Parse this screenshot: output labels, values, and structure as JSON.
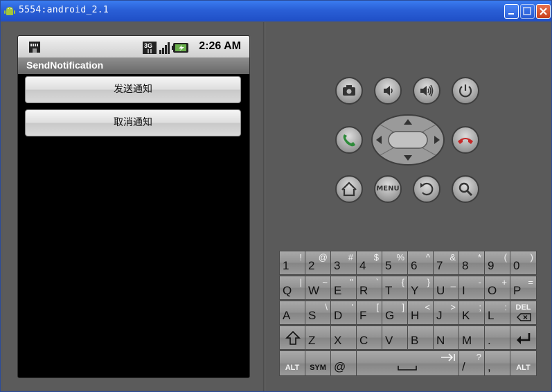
{
  "window": {
    "title": "5554:android_2.1"
  },
  "device": {
    "status_time": "2:26 AM",
    "app_title": "SendNotification",
    "buttons": [
      "发送通知",
      "取消通知"
    ]
  },
  "controls": {
    "menu_label": "MENU"
  },
  "keyboard": {
    "rows": [
      [
        {
          "k": "1",
          "a": "!"
        },
        {
          "k": "2",
          "a": "@"
        },
        {
          "k": "3",
          "a": "#"
        },
        {
          "k": "4",
          "a": "$"
        },
        {
          "k": "5",
          "a": "%"
        },
        {
          "k": "6",
          "a": "^"
        },
        {
          "k": "7",
          "a": "&"
        },
        {
          "k": "8",
          "a": "*"
        },
        {
          "k": "9",
          "a": "("
        },
        {
          "k": "0",
          "a": ")"
        }
      ],
      [
        {
          "k": "Q",
          "a": "|"
        },
        {
          "k": "W",
          "a": "~"
        },
        {
          "k": "E",
          "a": "\""
        },
        {
          "k": "R",
          "a": "`"
        },
        {
          "k": "T",
          "a": "{"
        },
        {
          "k": "Y",
          "a": "}"
        },
        {
          "k": "U",
          "a": "_"
        },
        {
          "k": "I",
          "a": "-"
        },
        {
          "k": "O",
          "a": "+"
        },
        {
          "k": "P",
          "a": "="
        }
      ],
      [
        {
          "k": "A",
          "a": ""
        },
        {
          "k": "S",
          "a": "\\"
        },
        {
          "k": "D",
          "a": "'"
        },
        {
          "k": "F",
          "a": "["
        },
        {
          "k": "G",
          "a": "]"
        },
        {
          "k": "H",
          "a": "<"
        },
        {
          "k": "J",
          "a": ">"
        },
        {
          "k": "K",
          "a": ";"
        },
        {
          "k": "L",
          "a": ":"
        },
        {
          "k": "DEL",
          "a": ""
        }
      ],
      [
        {
          "k": "",
          "a": ""
        },
        {
          "k": "Z",
          "a": ""
        },
        {
          "k": "X",
          "a": ""
        },
        {
          "k": "C",
          "a": ""
        },
        {
          "k": "V",
          "a": ""
        },
        {
          "k": "B",
          "a": ""
        },
        {
          "k": "N",
          "a": ""
        },
        {
          "k": "M",
          "a": ""
        },
        {
          "k": ".",
          "a": ""
        },
        {
          "k": "",
          "a": ""
        }
      ]
    ],
    "bottom": {
      "alt_left": "ALT",
      "sym": "SYM",
      "at": "@",
      "slash": "/",
      "slash_alt": "?",
      "comma": ",",
      "alt_right": "ALT"
    }
  },
  "colors": {
    "titlebar": "#2a5fd6",
    "call_green": "#2e8b3a",
    "end_red": "#c62828"
  }
}
